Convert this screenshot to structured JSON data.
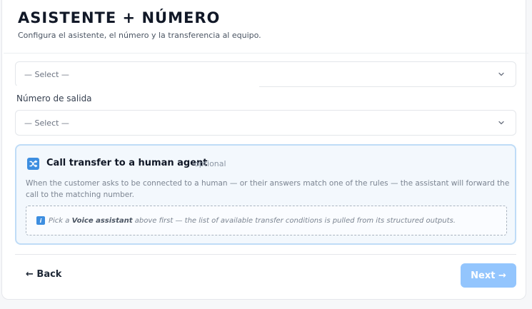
{
  "header": {
    "title": "ASISTENTE + NÚMERO",
    "subtitle": "Configura el asistente, el número y la transferencia al equipo."
  },
  "assistant_select": {
    "value": "— Select —",
    "icon": "chevron-down-icon"
  },
  "outbound_number": {
    "label": "Número de salida",
    "value": "— Select —",
    "icon": "chevron-down-icon"
  },
  "transfer": {
    "icon": "shuffle-icon",
    "title": "Call transfer to a human agent",
    "optional": "optional",
    "description": "When the customer asks to be connected to a human — or their answers match one of the rules — the assistant will forward the call to the matching number.",
    "notice": {
      "icon": "info-icon",
      "prefix": "Pick a",
      "emphasis": "Voice assistant",
      "suffix": "above first — the list of available transfer conditions is pulled from its structured outputs."
    },
    "accent_color": "#3d8ee0"
  },
  "footer": {
    "back_label": "← Back",
    "next_label": "Next →",
    "next_color": "#93c5fd"
  }
}
